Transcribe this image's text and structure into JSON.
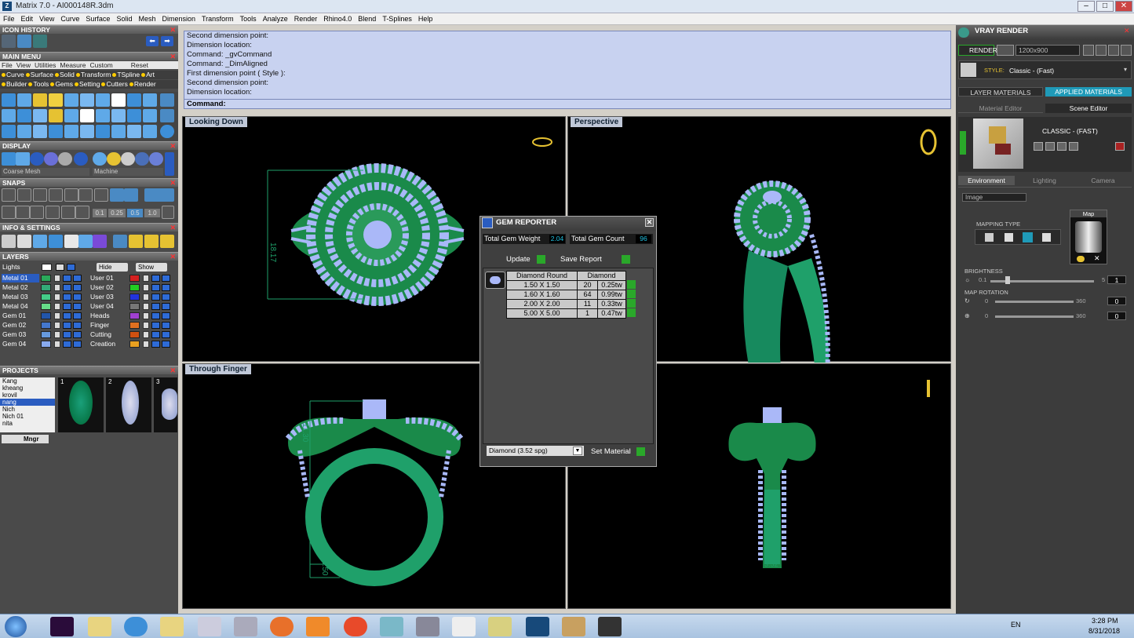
{
  "window": {
    "title": "Matrix 7.0 - AI000148R.3dm",
    "app_icon": "Z"
  },
  "menu": [
    "File",
    "Edit",
    "View",
    "Curve",
    "Surface",
    "Solid",
    "Mesh",
    "Dimension",
    "Transform",
    "Tools",
    "Analyze",
    "Render",
    "Rhino4.0",
    "Blend",
    "T-Splines",
    "Help"
  ],
  "left": {
    "icon_history": "ICON HISTORY",
    "main_menu": "MAIN MENU",
    "submenu": [
      "File",
      "View",
      "Utilities",
      "Measure",
      "Custom",
      "Reset"
    ],
    "categories1": [
      "Curve",
      "Surface",
      "Solid",
      "Transform",
      "TSpline",
      "Art"
    ],
    "categories2": [
      "Builder",
      "Tools",
      "Gems",
      "Setting",
      "Cutters",
      "Render"
    ],
    "display": "DISPLAY",
    "display_mesh": "Coarse Mesh",
    "display_machine": "Machine",
    "snaps": "SNAPS",
    "snap_vals": [
      "0.1",
      "0.25",
      "0.5",
      "1.0"
    ],
    "info": "INFO & SETTINGS",
    "layers": "LAYERS",
    "lights": "Lights",
    "hide": "Hide",
    "show": "Show",
    "layers_left": [
      "Metal 01",
      "Metal 02",
      "Metal 03",
      "Metal 04"
    ],
    "layers_right": [
      "User 01",
      "User 02",
      "User 03",
      "User 04"
    ],
    "gems_left": [
      "Gem 01",
      "Gem 02",
      "Gem 03",
      "Gem 04"
    ],
    "gems_right": [
      "Heads",
      "Finger",
      "Cutting",
      "Creation"
    ],
    "projects": "PROJECTS",
    "project_names": [
      "Kang",
      "kheang",
      "krovil",
      "nang",
      "Nich",
      "Nich 01",
      "nita"
    ],
    "mngr": "Mngr",
    "thumb_nums": [
      "1",
      "2",
      "3"
    ]
  },
  "command": {
    "lines": [
      "Second dimension point:",
      "Dimension location:",
      "Command: _gvCommand",
      "Command: _DimAligned",
      "First dimension point ( Style ):",
      "Second dimension point:",
      "Dimension location:"
    ],
    "prompt": "Command:"
  },
  "viewports": {
    "top_left": "Looking Down",
    "top_right": "Perspective",
    "bottom_left": "Through Finger",
    "dim_top": "18.17",
    "dim_side": "11.30",
    "dim_bottom": "1.50",
    "dim_front": "3.52"
  },
  "gem_reporter": {
    "title": "GEM REPORTER",
    "weight_label": "Total Gem Weight",
    "weight_value": "2.04",
    "count_label": "Total Gem Count",
    "count_value": "96",
    "update": "Update",
    "save": "Save Report",
    "col1": "Diamond Round",
    "col2": "Diamond",
    "rows": [
      {
        "size": "1.50 X 1.50",
        "count": "20",
        "tw": "0.25tw"
      },
      {
        "size": "1.60 X 1.60",
        "count": "64",
        "tw": "0.99tw"
      },
      {
        "size": "2.00 X 2.00",
        "count": "11",
        "tw": "0.33tw"
      },
      {
        "size": "5.00 X 5.00",
        "count": "1",
        "tw": "0.47tw"
      }
    ],
    "material": "Diamond    (3.52 spg)",
    "set_material": "Set Material"
  },
  "right": {
    "title": "VRAY RENDER",
    "render": "RENDER",
    "resolution": "1200x900",
    "style_label": "STYLE:",
    "style_value": "Classic - (Fast)",
    "tab_layer": "LAYER MATERIALS",
    "tab_applied": "APPLIED MATERIALS",
    "tab_mat_editor": "Material Editor",
    "tab_scene_editor": "Scene Editor",
    "scene_name": "CLASSIC - (FAST)",
    "env_tabs": [
      "Environment",
      "Lighting",
      "Camera"
    ],
    "env_select": "Image",
    "mapping": "MAPPING TYPE",
    "map": "Map",
    "brightness": "BRIGHTNESS",
    "b_min": "0.1",
    "b_max": "5",
    "b_val": "1",
    "map_rotation": "MAP ROTATION",
    "r_min": "0",
    "r_max": "360",
    "r_val": "0"
  },
  "taskbar": {
    "lang": "EN",
    "time": "3:28 PM",
    "date": "8/31/2018"
  }
}
